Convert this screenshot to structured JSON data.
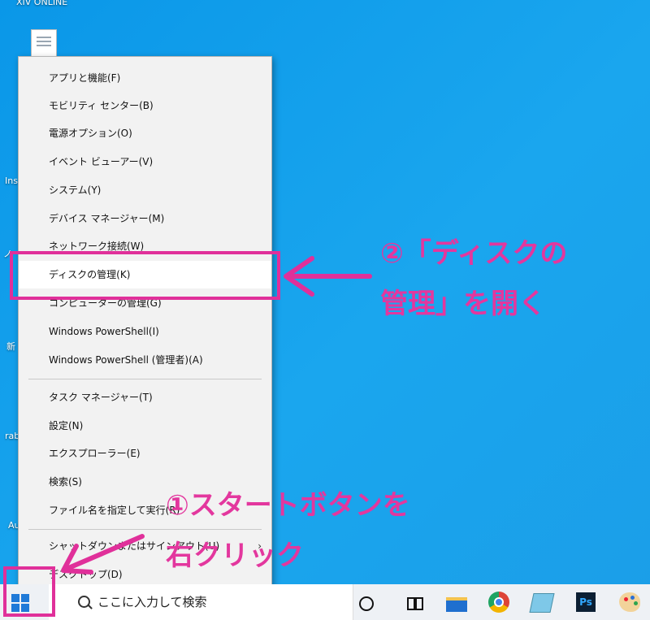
{
  "desktop": {
    "title_label": "XIV ONLINE",
    "edge_labels": [
      "Ins",
      "ノ",
      "新",
      "rab",
      "Au"
    ]
  },
  "context_menu": {
    "items": [
      {
        "label": "アプリと機能(F)"
      },
      {
        "label": "モビリティ センター(B)"
      },
      {
        "label": "電源オプション(O)"
      },
      {
        "label": "イベント ビューアー(V)"
      },
      {
        "label": "システム(Y)"
      },
      {
        "label": "デバイス マネージャー(M)"
      },
      {
        "label": "ネットワーク接続(W)"
      },
      {
        "label": "ディスクの管理(K)",
        "selected": true
      },
      {
        "label": "コンピューターの管理(G)"
      },
      {
        "label": "Windows PowerShell(I)"
      },
      {
        "label": "Windows PowerShell (管理者)(A)"
      },
      {
        "label": "タスク マネージャー(T)"
      },
      {
        "label": "設定(N)"
      },
      {
        "label": "エクスプローラー(E)"
      },
      {
        "label": "検索(S)"
      },
      {
        "label": "ファイル名を指定して実行(R)"
      },
      {
        "label": "シャットダウンまたはサインアウト(U)",
        "submenu": true
      },
      {
        "label": "デスクトップ(D)"
      }
    ]
  },
  "taskbar": {
    "search_placeholder": "ここに入力して検索",
    "ps_label": "Ps",
    "icons": [
      "windows-start-icon",
      "search-icon",
      "cortana-icon",
      "task-view-icon",
      "file-explorer-icon",
      "chrome-icon",
      "notepad-icon",
      "photoshop-icon",
      "paint-icon"
    ]
  },
  "annotations": {
    "step2_line1": "②「ディスクの",
    "step2_line2": "管理」を開く",
    "step1_line1": "①スタートボタンを",
    "step1_line2": "右クリック",
    "color": "#e3379e"
  }
}
